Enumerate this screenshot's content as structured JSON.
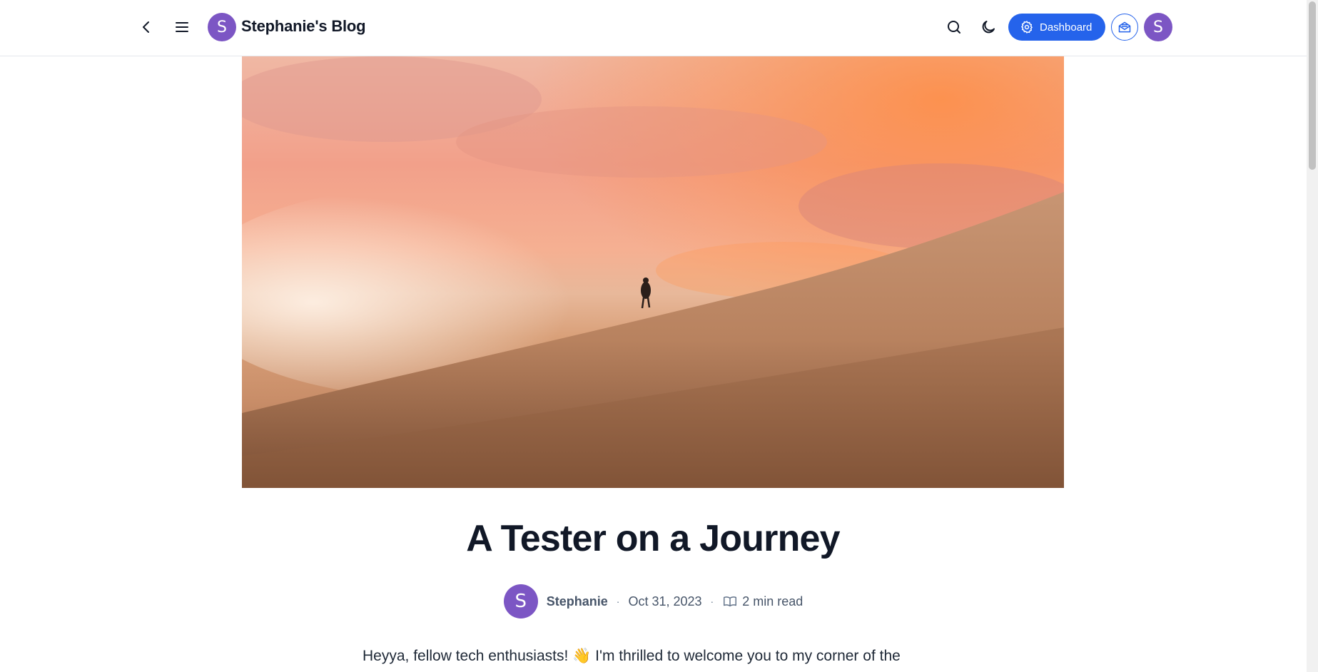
{
  "header": {
    "blog_title": "Stephanie's Blog",
    "blog_avatar_letter": "S",
    "dashboard_label": "Dashboard",
    "user_avatar_letter": "S",
    "icons": [
      "back-icon",
      "menu-icon",
      "search-icon",
      "moon-icon",
      "gear-icon",
      "newsletter-icon"
    ]
  },
  "colors": {
    "accent": "#2563eb",
    "avatar": "#7c56c4"
  },
  "post": {
    "title": "A Tester on a Journey",
    "author": "Stephanie",
    "author_avatar_letter": "S",
    "separator": "·",
    "date": "Oct 31, 2023",
    "read_time": "2 min read",
    "intro": "Heyya, fellow tech enthusiasts! 👋 I'm thrilled to welcome you to my corner of the"
  }
}
